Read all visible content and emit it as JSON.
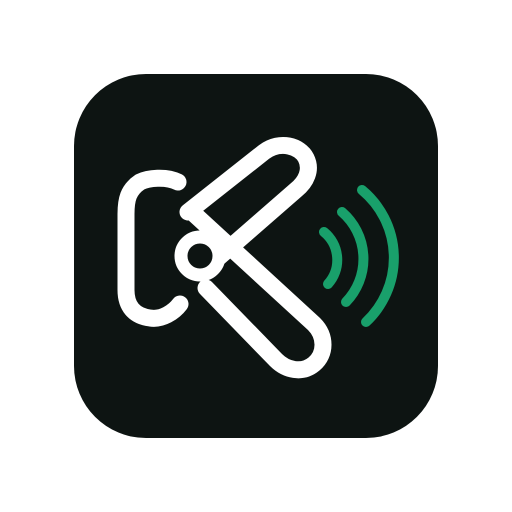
{
  "icon": {
    "name": "app-logo-icon",
    "glyph": "k-letter-sound-waves-icon",
    "colors": {
      "background": "#0d1412",
      "foreground": "#ffffff",
      "accent": "#19a06b",
      "page": "#ffffff"
    }
  }
}
